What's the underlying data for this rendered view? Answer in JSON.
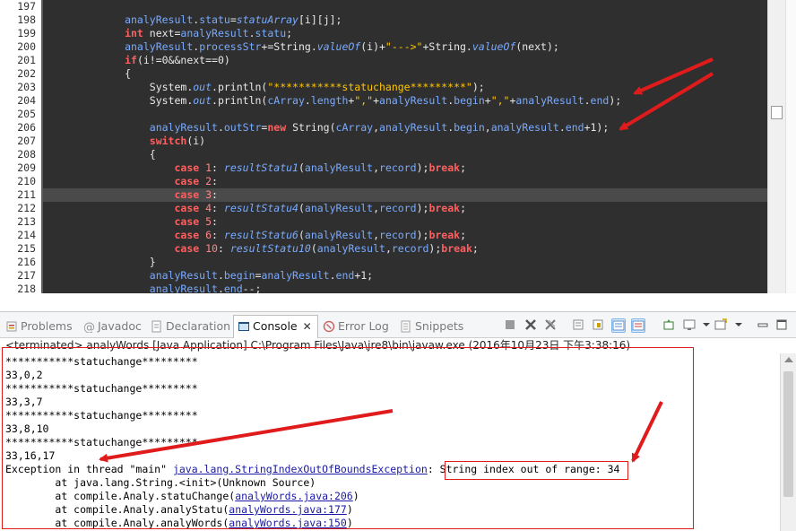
{
  "editor": {
    "lines": [
      {
        "num": "197",
        "segments": []
      },
      {
        "num": "198",
        "segments": [
          {
            "c": "tok-var",
            "t": "            analyResult"
          },
          {
            "c": "tok-plain",
            "t": "."
          },
          {
            "c": "tok-var",
            "t": "statu"
          },
          {
            "c": "tok-plain",
            "t": "="
          },
          {
            "c": "tok-ital",
            "t": "statuArray"
          },
          {
            "c": "tok-plain",
            "t": "[i][j];"
          }
        ]
      },
      {
        "num": "199",
        "segments": [
          {
            "c": "tok-kw",
            "t": "            int"
          },
          {
            "c": "tok-plain",
            "t": " next="
          },
          {
            "c": "tok-var",
            "t": "analyResult"
          },
          {
            "c": "tok-plain",
            "t": "."
          },
          {
            "c": "tok-var",
            "t": "statu"
          },
          {
            "c": "tok-plain",
            "t": ";"
          }
        ]
      },
      {
        "num": "200",
        "segments": [
          {
            "c": "tok-var",
            "t": "            analyResult"
          },
          {
            "c": "tok-plain",
            "t": "."
          },
          {
            "c": "tok-var",
            "t": "processStr"
          },
          {
            "c": "tok-plain",
            "t": "+=String."
          },
          {
            "c": "tok-ital",
            "t": "valueOf"
          },
          {
            "c": "tok-plain",
            "t": "(i)+"
          },
          {
            "c": "tok-str",
            "t": "\"--->\""
          },
          {
            "c": "tok-plain",
            "t": "+String."
          },
          {
            "c": "tok-ital",
            "t": "valueOf"
          },
          {
            "c": "tok-plain",
            "t": "(next);"
          }
        ]
      },
      {
        "num": "201",
        "segments": [
          {
            "c": "tok-kw",
            "t": "            if"
          },
          {
            "c": "tok-plain",
            "t": "(i!=0&&next==0)"
          }
        ]
      },
      {
        "num": "202",
        "segments": [
          {
            "c": "tok-plain",
            "t": "            {"
          }
        ]
      },
      {
        "num": "203",
        "segments": [
          {
            "c": "tok-plain",
            "t": "                System."
          },
          {
            "c": "tok-field",
            "t": "out"
          },
          {
            "c": "tok-plain",
            "t": ".println("
          },
          {
            "c": "tok-str",
            "t": "\"***********statuchange*********\""
          },
          {
            "c": "tok-plain",
            "t": ");"
          }
        ]
      },
      {
        "num": "204",
        "segments": [
          {
            "c": "tok-plain",
            "t": "                System."
          },
          {
            "c": "tok-field",
            "t": "out"
          },
          {
            "c": "tok-plain",
            "t": ".println("
          },
          {
            "c": "tok-var",
            "t": "cArray"
          },
          {
            "c": "tok-plain",
            "t": "."
          },
          {
            "c": "tok-var",
            "t": "length"
          },
          {
            "c": "tok-plain",
            "t": "+"
          },
          {
            "c": "tok-str",
            "t": "\",\""
          },
          {
            "c": "tok-plain",
            "t": "+"
          },
          {
            "c": "tok-var",
            "t": "analyResult"
          },
          {
            "c": "tok-plain",
            "t": "."
          },
          {
            "c": "tok-var",
            "t": "begin"
          },
          {
            "c": "tok-plain",
            "t": "+"
          },
          {
            "c": "tok-str",
            "t": "\",\""
          },
          {
            "c": "tok-plain",
            "t": "+"
          },
          {
            "c": "tok-var",
            "t": "analyResult"
          },
          {
            "c": "tok-plain",
            "t": "."
          },
          {
            "c": "tok-var",
            "t": "end"
          },
          {
            "c": "tok-plain",
            "t": ");"
          }
        ]
      },
      {
        "num": "205",
        "segments": []
      },
      {
        "num": "206",
        "segments": [
          {
            "c": "tok-var",
            "t": "                analyResult"
          },
          {
            "c": "tok-plain",
            "t": "."
          },
          {
            "c": "tok-var",
            "t": "outStr"
          },
          {
            "c": "tok-plain",
            "t": "="
          },
          {
            "c": "tok-kw",
            "t": "new"
          },
          {
            "c": "tok-plain",
            "t": " String("
          },
          {
            "c": "tok-var",
            "t": "cArray"
          },
          {
            "c": "tok-plain",
            "t": ","
          },
          {
            "c": "tok-var",
            "t": "analyResult"
          },
          {
            "c": "tok-plain",
            "t": "."
          },
          {
            "c": "tok-var",
            "t": "begin"
          },
          {
            "c": "tok-plain",
            "t": ","
          },
          {
            "c": "tok-var",
            "t": "analyResult"
          },
          {
            "c": "tok-plain",
            "t": "."
          },
          {
            "c": "tok-var",
            "t": "end"
          },
          {
            "c": "tok-plain",
            "t": "+1);"
          }
        ]
      },
      {
        "num": "207",
        "segments": [
          {
            "c": "tok-kw",
            "t": "                switch"
          },
          {
            "c": "tok-plain",
            "t": "(i)"
          }
        ]
      },
      {
        "num": "208",
        "segments": [
          {
            "c": "tok-plain",
            "t": "                {"
          }
        ]
      },
      {
        "num": "209",
        "segments": [
          {
            "c": "tok-kw",
            "t": "                    case"
          },
          {
            "c": "tok-num",
            "t": " 1"
          },
          {
            "c": "tok-plain",
            "t": ": "
          },
          {
            "c": "tok-ital",
            "t": "resultStatu1"
          },
          {
            "c": "tok-plain",
            "t": "("
          },
          {
            "c": "tok-var",
            "t": "analyResult"
          },
          {
            "c": "tok-plain",
            "t": ","
          },
          {
            "c": "tok-var",
            "t": "record"
          },
          {
            "c": "tok-plain",
            "t": ");"
          },
          {
            "c": "tok-kw",
            "t": "break"
          },
          {
            "c": "tok-plain",
            "t": ";"
          }
        ]
      },
      {
        "num": "210",
        "segments": [
          {
            "c": "tok-kw",
            "t": "                    case"
          },
          {
            "c": "tok-num",
            "t": " 2"
          },
          {
            "c": "tok-plain",
            "t": ":"
          }
        ]
      },
      {
        "num": "211",
        "current": true,
        "segments": [
          {
            "c": "tok-kw",
            "t": "                    case"
          },
          {
            "c": "tok-num",
            "t": " 3"
          },
          {
            "c": "tok-plain",
            "t": ":"
          }
        ]
      },
      {
        "num": "212",
        "segments": [
          {
            "c": "tok-kw",
            "t": "                    case"
          },
          {
            "c": "tok-num",
            "t": " 4"
          },
          {
            "c": "tok-plain",
            "t": ": "
          },
          {
            "c": "tok-ital",
            "t": "resultStatu4"
          },
          {
            "c": "tok-plain",
            "t": "("
          },
          {
            "c": "tok-var",
            "t": "analyResult"
          },
          {
            "c": "tok-plain",
            "t": ","
          },
          {
            "c": "tok-var",
            "t": "record"
          },
          {
            "c": "tok-plain",
            "t": ");"
          },
          {
            "c": "tok-kw",
            "t": "break"
          },
          {
            "c": "tok-plain",
            "t": ";"
          }
        ]
      },
      {
        "num": "213",
        "segments": [
          {
            "c": "tok-kw",
            "t": "                    case"
          },
          {
            "c": "tok-num",
            "t": " 5"
          },
          {
            "c": "tok-plain",
            "t": ":"
          }
        ]
      },
      {
        "num": "214",
        "segments": [
          {
            "c": "tok-kw",
            "t": "                    case"
          },
          {
            "c": "tok-num",
            "t": " 6"
          },
          {
            "c": "tok-plain",
            "t": ": "
          },
          {
            "c": "tok-ital",
            "t": "resultStatu6"
          },
          {
            "c": "tok-plain",
            "t": "("
          },
          {
            "c": "tok-var",
            "t": "analyResult"
          },
          {
            "c": "tok-plain",
            "t": ","
          },
          {
            "c": "tok-var",
            "t": "record"
          },
          {
            "c": "tok-plain",
            "t": ");"
          },
          {
            "c": "tok-kw",
            "t": "break"
          },
          {
            "c": "tok-plain",
            "t": ";"
          }
        ]
      },
      {
        "num": "215",
        "segments": [
          {
            "c": "tok-kw",
            "t": "                    case"
          },
          {
            "c": "tok-num",
            "t": " 10"
          },
          {
            "c": "tok-plain",
            "t": ": "
          },
          {
            "c": "tok-ital",
            "t": "resultStatu10"
          },
          {
            "c": "tok-plain",
            "t": "("
          },
          {
            "c": "tok-var",
            "t": "analyResult"
          },
          {
            "c": "tok-plain",
            "t": ","
          },
          {
            "c": "tok-var",
            "t": "record"
          },
          {
            "c": "tok-plain",
            "t": ");"
          },
          {
            "c": "tok-kw",
            "t": "break"
          },
          {
            "c": "tok-plain",
            "t": ";"
          }
        ]
      },
      {
        "num": "216",
        "segments": [
          {
            "c": "tok-plain",
            "t": "                }"
          }
        ]
      },
      {
        "num": "217",
        "segments": [
          {
            "c": "tok-var",
            "t": "                analyResult"
          },
          {
            "c": "tok-plain",
            "t": "."
          },
          {
            "c": "tok-var",
            "t": "begin"
          },
          {
            "c": "tok-plain",
            "t": "="
          },
          {
            "c": "tok-var",
            "t": "analyResult"
          },
          {
            "c": "tok-plain",
            "t": "."
          },
          {
            "c": "tok-var",
            "t": "end"
          },
          {
            "c": "tok-plain",
            "t": "+1;"
          }
        ]
      },
      {
        "num": "218",
        "segments": [
          {
            "c": "tok-var",
            "t": "                analyResult"
          },
          {
            "c": "tok-plain",
            "t": "."
          },
          {
            "c": "tok-var",
            "t": "end"
          },
          {
            "c": "tok-plain",
            "t": "--;"
          }
        ]
      }
    ]
  },
  "views": {
    "tabs": [
      {
        "id": "problems",
        "label": "Problems",
        "icon": "problems-icon",
        "active": false
      },
      {
        "id": "javadoc",
        "label": "Javadoc",
        "icon": "javadoc-icon",
        "active": false
      },
      {
        "id": "declaration",
        "label": "Declaration",
        "icon": "declaration-icon",
        "active": false
      },
      {
        "id": "console",
        "label": "Console",
        "icon": "console-icon",
        "active": true,
        "close": "✕"
      },
      {
        "id": "error-log",
        "label": "Error Log",
        "icon": "error-log-icon",
        "active": false
      },
      {
        "id": "snippets",
        "label": "Snippets",
        "icon": "snippets-icon",
        "active": false
      }
    ]
  },
  "console": {
    "header": "<terminated> analyWords [Java Application] C:\\Program Files\\Java\\jre8\\bin\\javaw.exe (2016年10月23日 下午3:38:16)",
    "lines": [
      {
        "segments": [
          {
            "c": "",
            "t": "***********statuchange*********"
          }
        ]
      },
      {
        "segments": [
          {
            "c": "",
            "t": "33,0,2"
          }
        ]
      },
      {
        "segments": [
          {
            "c": "",
            "t": "***********statuchange*********"
          }
        ]
      },
      {
        "segments": [
          {
            "c": "",
            "t": "33,3,7"
          }
        ]
      },
      {
        "segments": [
          {
            "c": "",
            "t": "***********statuchange*********"
          }
        ]
      },
      {
        "segments": [
          {
            "c": "",
            "t": "33,8,10"
          }
        ]
      },
      {
        "segments": [
          {
            "c": "",
            "t": "***********statuchange*********"
          }
        ]
      },
      {
        "segments": [
          {
            "c": "",
            "t": "33,16,17"
          }
        ]
      },
      {
        "segments": [
          {
            "c": "err",
            "t": "Exception in thread \"main\" "
          },
          {
            "c": "link",
            "t": "java.lang.StringIndexOutOfBoundsException"
          },
          {
            "c": "err",
            "t": ": String index out of range: 34"
          }
        ]
      },
      {
        "segments": [
          {
            "c": "err",
            "t": "\tat java.lang.String.<init>(Unknown Source)"
          }
        ]
      },
      {
        "segments": [
          {
            "c": "err",
            "t": "\tat compile.Analy.statuChange("
          },
          {
            "c": "link",
            "t": "analyWords.java:206"
          },
          {
            "c": "err",
            "t": ")"
          }
        ]
      },
      {
        "segments": [
          {
            "c": "err",
            "t": "\tat compile.Analy.analyStatu("
          },
          {
            "c": "link",
            "t": "analyWords.java:177"
          },
          {
            "c": "err",
            "t": ")"
          }
        ]
      },
      {
        "segments": [
          {
            "c": "err",
            "t": "\tat compile.Analy.analyWords("
          },
          {
            "c": "link",
            "t": "analyWords.java:150"
          },
          {
            "c": "err",
            "t": ")"
          }
        ]
      }
    ]
  },
  "colors": {
    "annotation": "#e01b1b",
    "editor_bg": "#2f2f2f",
    "current_line": "#4a4a4a"
  }
}
